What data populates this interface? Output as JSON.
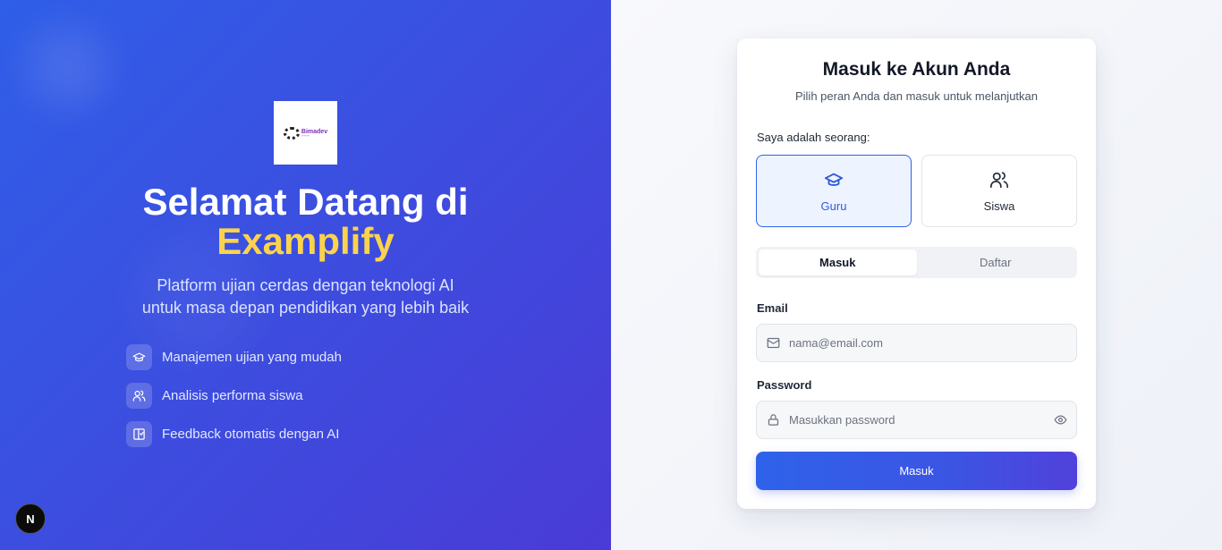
{
  "hero": {
    "logo_text": "Bimadev",
    "title_line1": "Selamat Datang di",
    "title_brand": "Examplify",
    "subtitle_line1": "Platform ujian cerdas dengan teknologi AI",
    "subtitle_line2": "untuk masa depan pendidikan yang lebih baik",
    "features": [
      {
        "icon": "graduation-cap-icon",
        "label": "Manajemen ujian yang mudah"
      },
      {
        "icon": "users-icon",
        "label": "Analisis performa siswa"
      },
      {
        "icon": "book-check-icon",
        "label": "Feedback otomatis dengan AI"
      }
    ]
  },
  "dev_badge": {
    "label": "N"
  },
  "card": {
    "title": "Masuk ke Akun Anda",
    "subtitle": "Pilih peran Anda dan masuk untuk melanjutkan",
    "role_label": "Saya adalah seorang:",
    "roles": [
      {
        "label": "Guru",
        "icon": "graduation-cap-icon",
        "selected": true
      },
      {
        "label": "Siswa",
        "icon": "users-icon",
        "selected": false
      }
    ],
    "tabs": [
      {
        "label": "Masuk",
        "active": true
      },
      {
        "label": "Daftar",
        "active": false
      }
    ],
    "email": {
      "label": "Email",
      "value": "",
      "placeholder": "nama@email.com",
      "icon": "mail-icon"
    },
    "password": {
      "label": "Password",
      "value": "",
      "placeholder": "Masukkan password",
      "icon": "lock-icon",
      "toggle_icon": "eye-icon"
    },
    "submit_label": "Masuk"
  },
  "colors": {
    "hero_gradient_start": "#2f5ee8",
    "hero_gradient_end": "#4a3bd6",
    "brand_yellow": "#fcd34d",
    "primary": "#2f62e8",
    "selected_role_bg": "#eef4ff"
  }
}
